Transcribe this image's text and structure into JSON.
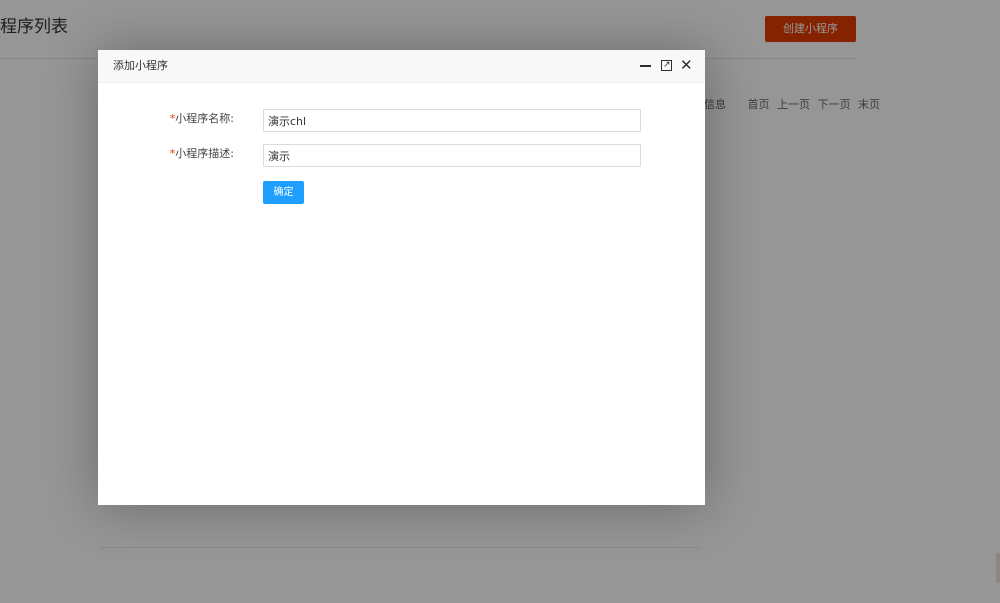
{
  "page": {
    "title": "程序列表",
    "create_button_label": "创建小程序",
    "pager": {
      "info": "信息",
      "links": [
        "首页",
        "上一页",
        "下一页",
        "末页"
      ]
    }
  },
  "dialog": {
    "title": "添加小程序",
    "controls": {
      "minimize_icon": "minimize-icon",
      "maximize_icon": "maximize-icon",
      "close_icon": "close-icon"
    },
    "form": {
      "name_field": {
        "required_mark": "*",
        "label": "小程序名称:",
        "value": "演示chl"
      },
      "desc_field": {
        "required_mark": "*",
        "label": "小程序描述:",
        "value": "演示"
      },
      "submit_label": "确定"
    }
  },
  "colors": {
    "overlay": "#000000",
    "primary_button": "#1e9fff",
    "danger_button": "#e23a00",
    "required_mark": "#e23a00"
  }
}
